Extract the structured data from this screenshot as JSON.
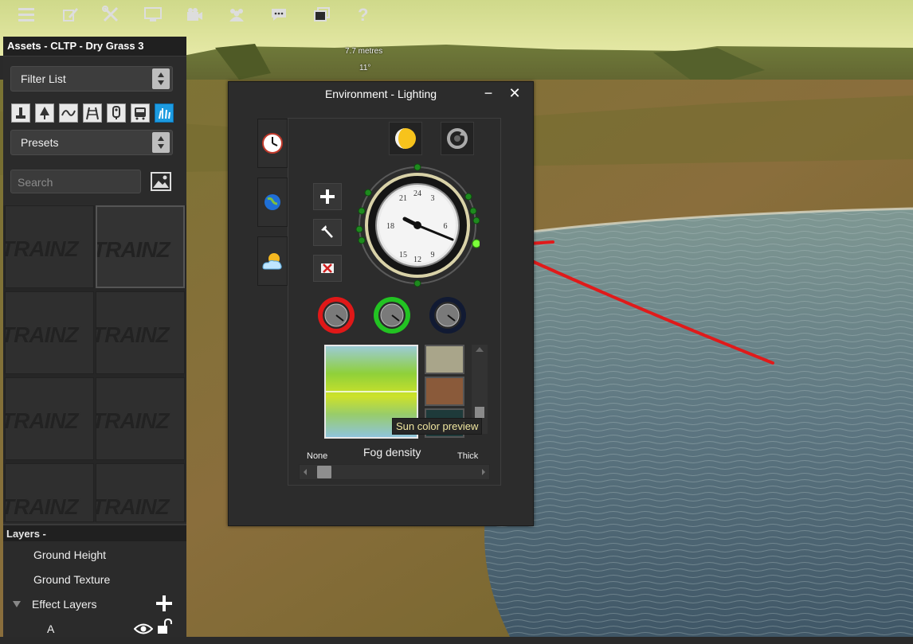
{
  "scene": {
    "distance_readout": "7.7 metres",
    "angle_readout": "11°"
  },
  "toolbar": {
    "buttons": [
      {
        "name": "menu-icon"
      },
      {
        "name": "edit-icon"
      },
      {
        "name": "tools-icon"
      },
      {
        "name": "monitor-icon"
      },
      {
        "name": "camera-icon"
      },
      {
        "name": "drivers-icon"
      },
      {
        "name": "chat-icon"
      },
      {
        "name": "windows-icon"
      },
      {
        "name": "help-icon"
      }
    ]
  },
  "assets_panel": {
    "title": "Assets - CLTP - Dry Grass 3",
    "filter_list_label": "Filter List",
    "filter_icons": [
      "object-icon",
      "tree-icon",
      "spline-icon",
      "track-icon",
      "traffic-icon",
      "train-icon",
      "grass-icon"
    ],
    "active_filter": "grass-icon",
    "presets_label": "Presets",
    "search_placeholder": "Search",
    "thumbnail_logo": "TRAINZ"
  },
  "layers": {
    "header": "Layers -",
    "items": [
      {
        "label": "Ground Height"
      },
      {
        "label": "Ground Texture"
      },
      {
        "label": "Effect Layers"
      },
      {
        "label": "A"
      }
    ]
  },
  "dialog": {
    "title": "Environment - Lighting",
    "minimize": "−",
    "close": "✕",
    "tooltip": "Sun color preview",
    "fog_density_label": "Fog density",
    "fog_min_label": "None",
    "fog_max_label": "Thick",
    "fog_density_value": 0.05,
    "knob_colors": [
      "#e01818",
      "#22c322",
      "#111a33"
    ],
    "swatch_colors": [
      "#a9a58a",
      "#8a5a3a",
      "#1e3a3a"
    ]
  }
}
